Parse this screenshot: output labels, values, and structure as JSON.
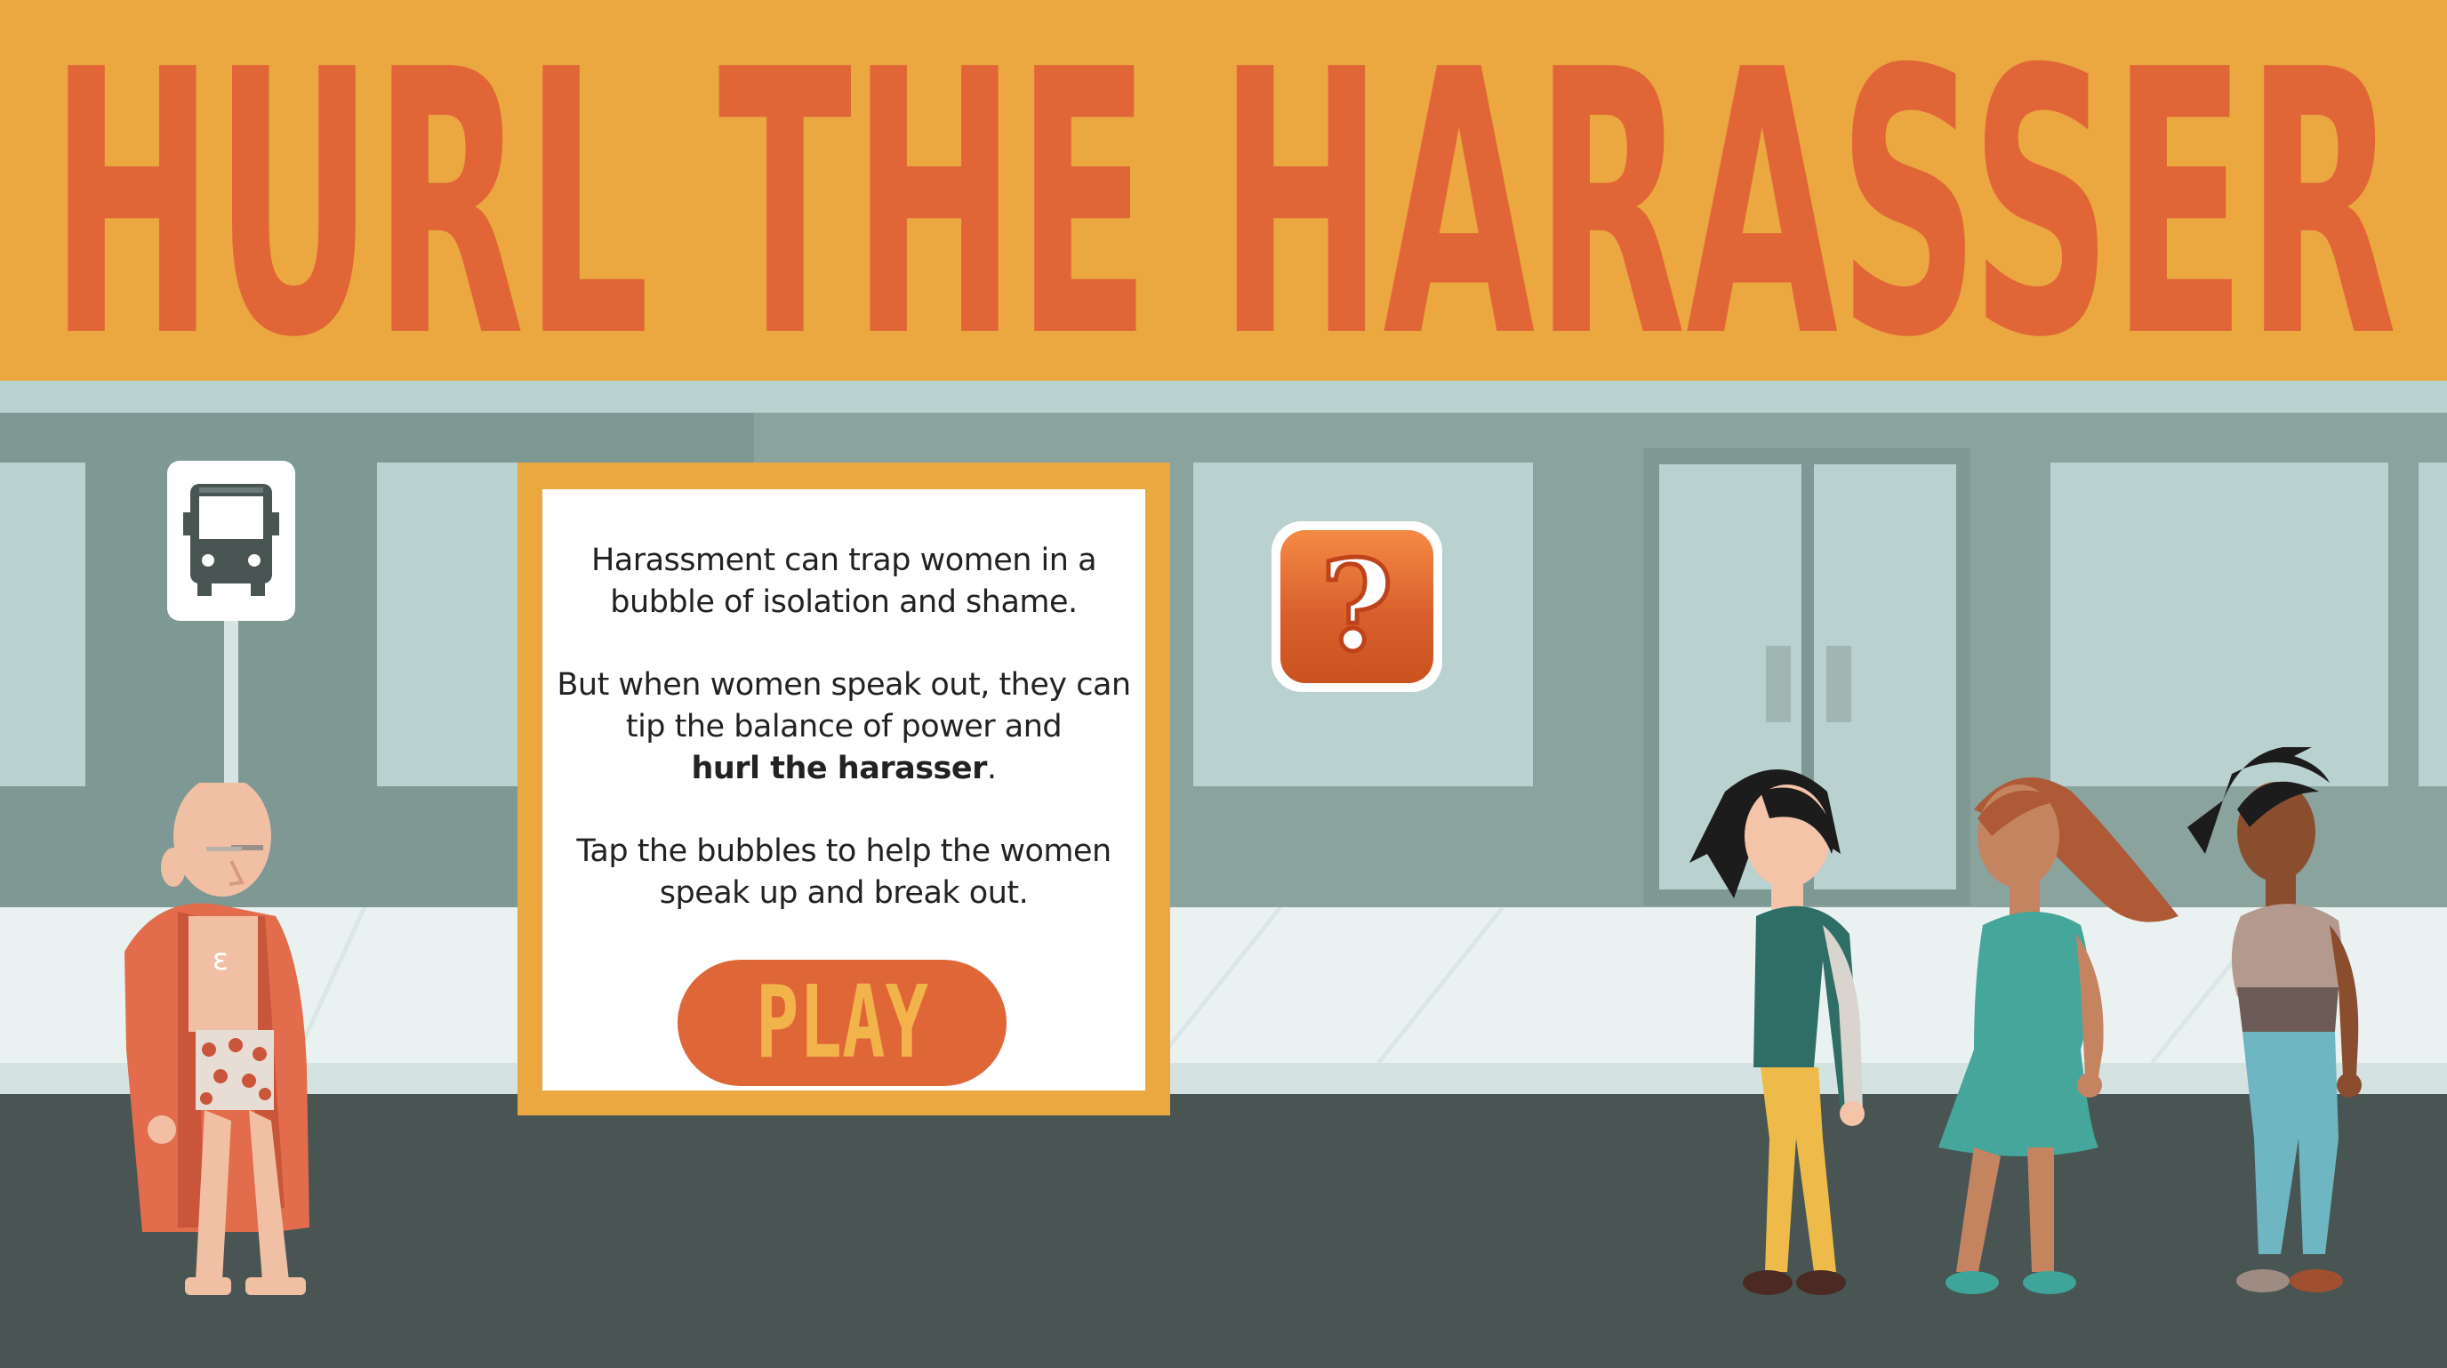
{
  "game": {
    "title": "HURL THE HARASSER"
  },
  "intro_panel": {
    "paragraph1_line1": "Harassment can trap women in a",
    "paragraph1_line2": "bubble of isolation and shame.",
    "paragraph2_line1": "But when women speak out, they can",
    "paragraph2_line2": "tip the balance of power and",
    "paragraph2_bold": "hurl the harasser",
    "paragraph2_end": ".",
    "paragraph3_line1": "Tap the bubbles to help the women",
    "paragraph3_line2": "speak up and break out.",
    "play_label": "PLAY"
  },
  "help_button": {
    "glyph": "?",
    "icon": "question-mark-icon"
  },
  "bus_stop": {
    "icon": "bus-icon"
  },
  "characters": {
    "harasser": "harasser-character",
    "women": [
      "woman-black-hair",
      "woman-long-brown-hair",
      "woman-ponytail"
    ]
  },
  "colors": {
    "banner": "#eba740",
    "title": "#e06637",
    "play_button": "#df6636",
    "play_text": "#f1b34a",
    "wall": "#8aa39d",
    "road": "#485553"
  }
}
